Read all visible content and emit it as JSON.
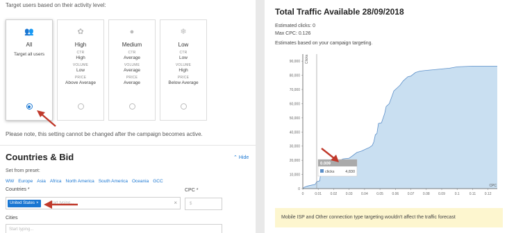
{
  "targeting": {
    "intro": "Target users based on their activity level:",
    "cards": [
      {
        "name": "All",
        "subtitle": "Target all users",
        "icon": "users-icon",
        "selected": true
      },
      {
        "name": "High",
        "icon": "flame-icon",
        "selected": false,
        "ctr_label": "CTR",
        "ctr": "High",
        "volume_label": "VOLUME",
        "volume": "Low",
        "price_label": "PRICE",
        "price": "Above Average"
      },
      {
        "name": "Medium",
        "icon": "user-icon",
        "selected": false,
        "ctr_label": "CTR",
        "ctr": "Average",
        "volume_label": "VOLUME",
        "volume": "Average",
        "price_label": "PRICE",
        "price": "Average"
      },
      {
        "name": "Low",
        "icon": "snowflake-icon",
        "selected": false,
        "ctr_label": "CTR",
        "ctr": "Low",
        "volume_label": "VOLUME",
        "volume": "High",
        "price_label": "PRICE",
        "price": "Below Average"
      }
    ],
    "note": "Please note, this setting cannot be changed after the campaign becomes active."
  },
  "countries_bid": {
    "title": "Countries & Bid",
    "hide_label": "Hide",
    "preset_label": "Set from preset:",
    "presets": [
      "WW",
      "Europe",
      "Asia",
      "Africa",
      "North America",
      "South America",
      "Oceania",
      "GCC"
    ],
    "countries_label": "Countries *",
    "selected_country": "United States",
    "countries_placeholder": "Start typing...",
    "cpc_label": "CPC *",
    "cpc_placeholder": "$",
    "cities_label": "Cities",
    "cities_placeholder": "Start typing..."
  },
  "traffic": {
    "title": "Total Traffic Available 28/09/2018",
    "estimated_clicks": "Estimated clicks: 0",
    "max_cpc": "Max CPC: 0.126",
    "estimates_note": "Estimates based on your campaign targeting.",
    "info_bar": "Mobile ISP and Other connection type targeting wouldn't affect the traffic forecast",
    "colors": {
      "fill": "#c9dff1",
      "line": "#5b8fc9",
      "accent": "#1976d2",
      "info_bg": "#fdf6cf"
    }
  },
  "chart_data": {
    "type": "area",
    "xlabel": "CPC",
    "ylabel": "Clicks",
    "xlim": [
      0,
      0.126
    ],
    "ylim": [
      0,
      95000
    ],
    "x_ticks": [
      "0",
      "0.01",
      "0.02",
      "0.03",
      "0.04",
      "0.05",
      "0.06",
      "0.07",
      "0.08",
      "0.09",
      "0.1",
      "0.11",
      "0.12"
    ],
    "y_ticks": [
      "0",
      "10,000",
      "20,000",
      "30,000",
      "40,000",
      "50,000",
      "60,000",
      "70,000",
      "80,000",
      "90,000"
    ],
    "points": [
      [
        0,
        0
      ],
      [
        0.001,
        1000
      ],
      [
        0.003,
        1800
      ],
      [
        0.005,
        2300
      ],
      [
        0.008,
        3000
      ],
      [
        0.009,
        4830
      ],
      [
        0.011,
        5500
      ],
      [
        0.012,
        15000
      ],
      [
        0.014,
        16500
      ],
      [
        0.017,
        17000
      ],
      [
        0.02,
        18000
      ],
      [
        0.023,
        19500
      ],
      [
        0.026,
        21000
      ],
      [
        0.03,
        21500
      ],
      [
        0.032,
        23000
      ],
      [
        0.035,
        25500
      ],
      [
        0.038,
        26500
      ],
      [
        0.041,
        28000
      ],
      [
        0.043,
        29000
      ],
      [
        0.045,
        30500
      ],
      [
        0.046,
        33000
      ],
      [
        0.047,
        38000
      ],
      [
        0.048,
        39000
      ],
      [
        0.049,
        46000
      ],
      [
        0.051,
        46500
      ],
      [
        0.053,
        53000
      ],
      [
        0.054,
        58000
      ],
      [
        0.056,
        60000
      ],
      [
        0.058,
        66000
      ],
      [
        0.059,
        69000
      ],
      [
        0.061,
        71000
      ],
      [
        0.063,
        73000
      ],
      [
        0.065,
        76000
      ],
      [
        0.068,
        79000
      ],
      [
        0.07,
        79500
      ],
      [
        0.073,
        82000
      ],
      [
        0.076,
        83000
      ],
      [
        0.08,
        83500
      ],
      [
        0.085,
        84000
      ],
      [
        0.09,
        84500
      ],
      [
        0.095,
        85000
      ],
      [
        0.1,
        86000
      ],
      [
        0.11,
        86500
      ],
      [
        0.12,
        86500
      ],
      [
        0.126,
        86500
      ]
    ],
    "tooltip": {
      "cpc": "0.009",
      "series": "clicks",
      "value": "4,830"
    }
  }
}
